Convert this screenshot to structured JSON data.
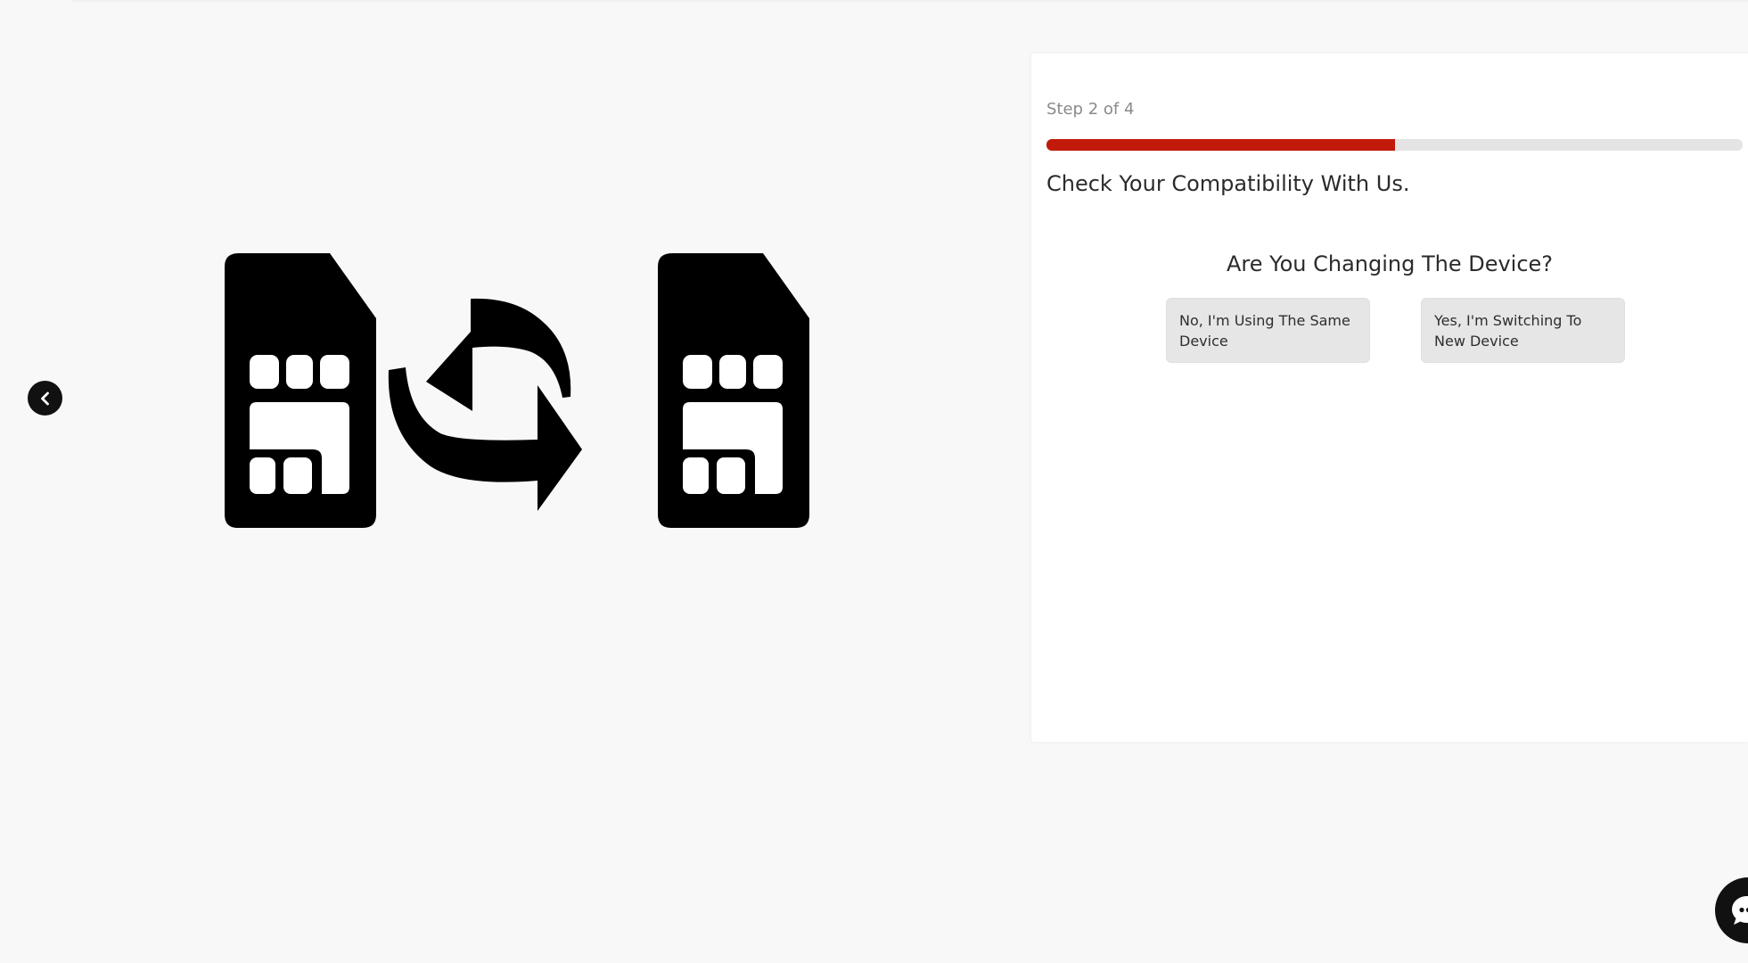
{
  "icons": {
    "back": "chevron-left-icon",
    "hero": [
      "sim-card-icon",
      "swap-arrows-icon",
      "sim-card-icon"
    ],
    "chat": "chat-bubble-icon"
  },
  "colors": {
    "progress_fill": "#c21a0a",
    "progress_track": "#e4e4e4",
    "option_bg": "#e6e6e6"
  },
  "wizard": {
    "step_label": "Step 2 of 4",
    "progress": 0.5,
    "heading": "Check Your Compatibility With Us.",
    "question": "Are You Changing The Device?",
    "options": [
      {
        "label": "No, I'm Using The Same Device"
      },
      {
        "label": "Yes, I'm Switching To New Device"
      }
    ]
  }
}
